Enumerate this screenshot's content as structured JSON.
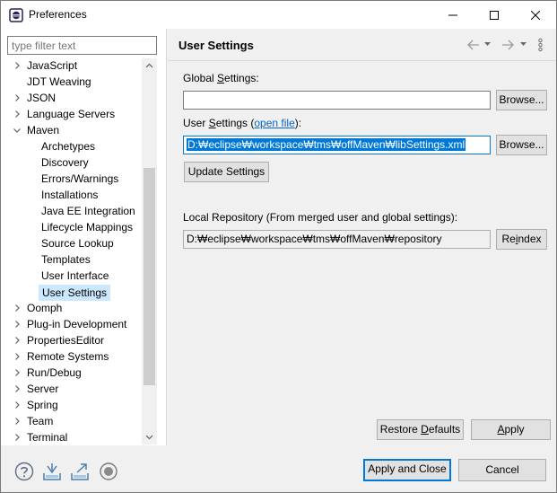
{
  "window": {
    "title": "Preferences"
  },
  "filter": {
    "placeholder": "type filter text"
  },
  "tree": [
    {
      "label": "JavaScript",
      "level": 0,
      "arrow": "right"
    },
    {
      "label": "JDT Weaving",
      "level": 0,
      "arrow": "none"
    },
    {
      "label": "JSON",
      "level": 0,
      "arrow": "right"
    },
    {
      "label": "Language Servers",
      "level": 0,
      "arrow": "right"
    },
    {
      "label": "Maven",
      "level": 0,
      "arrow": "down"
    },
    {
      "label": "Archetypes",
      "level": 1,
      "arrow": "none"
    },
    {
      "label": "Discovery",
      "level": 1,
      "arrow": "none"
    },
    {
      "label": "Errors/Warnings",
      "level": 1,
      "arrow": "none"
    },
    {
      "label": "Installations",
      "level": 1,
      "arrow": "none"
    },
    {
      "label": "Java EE Integration",
      "level": 1,
      "arrow": "none"
    },
    {
      "label": "Lifecycle Mappings",
      "level": 1,
      "arrow": "none"
    },
    {
      "label": "Source Lookup",
      "level": 1,
      "arrow": "none"
    },
    {
      "label": "Templates",
      "level": 1,
      "arrow": "none"
    },
    {
      "label": "User Interface",
      "level": 1,
      "arrow": "none"
    },
    {
      "label": "User Settings",
      "level": 1,
      "arrow": "none",
      "selected": true
    },
    {
      "label": "Oomph",
      "level": 0,
      "arrow": "right"
    },
    {
      "label": "Plug-in Development",
      "level": 0,
      "arrow": "right"
    },
    {
      "label": "PropertiesEditor",
      "level": 0,
      "arrow": "right"
    },
    {
      "label": "Remote Systems",
      "level": 0,
      "arrow": "right"
    },
    {
      "label": "Run/Debug",
      "level": 0,
      "arrow": "right"
    },
    {
      "label": "Server",
      "level": 0,
      "arrow": "right"
    },
    {
      "label": "Spring",
      "level": 0,
      "arrow": "right"
    },
    {
      "label": "Team",
      "level": 0,
      "arrow": "right"
    },
    {
      "label": "Terminal",
      "level": 0,
      "arrow": "right"
    }
  ],
  "page": {
    "title": "User Settings",
    "global_settings_label_pre": "Global ",
    "global_settings_label_mn": "S",
    "global_settings_label_post": "ettings:",
    "global_settings_value": "",
    "browse_label_pre": "Browse",
    "browse_label_post": "...",
    "user_settings_label_pre": "User ",
    "user_settings_label_mn": "S",
    "user_settings_label_mid": "ettings (",
    "open_file_link": "open file",
    "user_settings_label_post": "):",
    "user_settings_value": "D:₩eclipse₩workspace₩tms₩offMaven₩libSettings.xml",
    "update_settings_label": "Update Settings",
    "local_repo_label": "Local Repository (From merged user and global settings):",
    "local_repo_value": "D:₩eclipse₩workspace₩tms₩offMaven₩repository",
    "reindex_pre": "Re",
    "reindex_mn": "i",
    "reindex_post": "ndex",
    "restore_defaults_pre": "Restore ",
    "restore_defaults_mn": "D",
    "restore_defaults_post": "efaults",
    "apply_mn": "A",
    "apply_post": "pply"
  },
  "footer": {
    "apply_and_close": "Apply and Close",
    "cancel": "Cancel"
  },
  "colors": {
    "selection": "#0078d7",
    "tree_selected": "#cce8ff",
    "link": "#0066cc"
  }
}
